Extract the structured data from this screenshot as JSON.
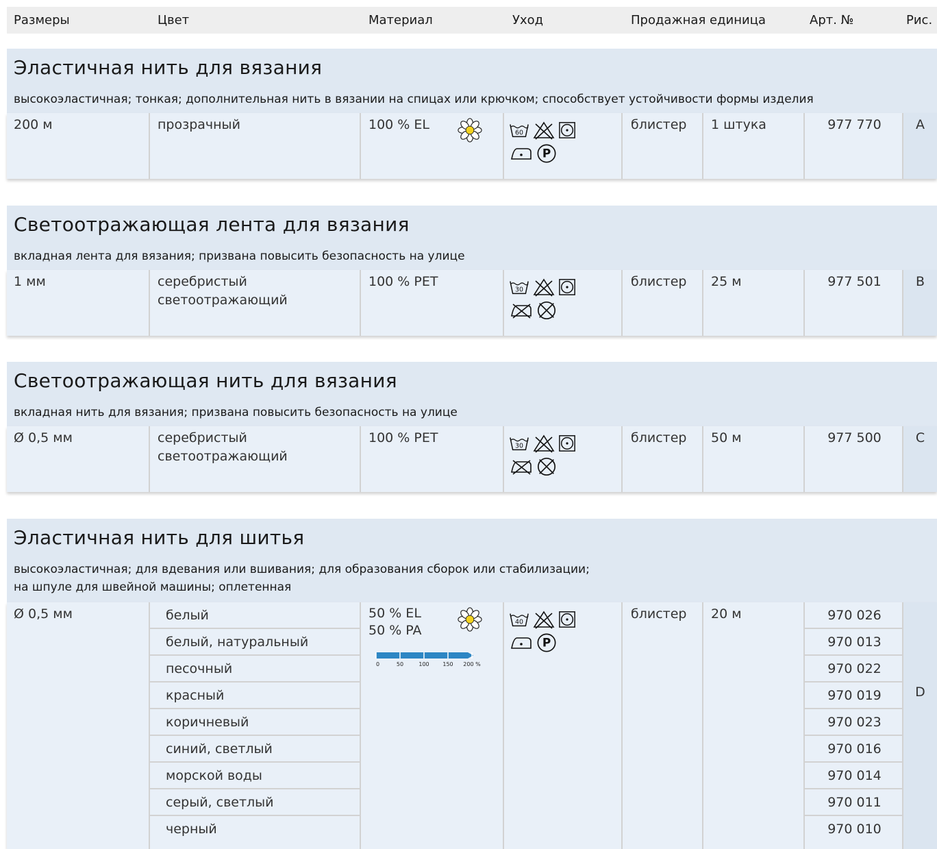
{
  "header": {
    "size": "Размеры",
    "color": "Цвет",
    "material": "Материал",
    "care": "Уход",
    "unit": "Продажная единица",
    "art": "Арт. №",
    "pic": "Рис."
  },
  "sections": [
    {
      "title": "Эластичная нить для вязания",
      "description": "высокоэластичная; тонкая; дополнительная нить в вязании на спицах или крючком; способствует устойчивости формы изделия",
      "size": "200 м",
      "color": "прозрачный",
      "material": "100 % EL",
      "wash_temp": "60",
      "pack": "блистер",
      "quantity": "1 штука",
      "art": "977 770",
      "pic": "A"
    },
    {
      "title": "Светоотражающая лента для вязания",
      "description": "вкладная лента для вязания; призвана повысить безопасность на улице",
      "size": "1 мм",
      "color": "серебристый светоотражающий",
      "material": "100 % PET",
      "wash_temp": "30",
      "pack": "блистер",
      "quantity": "25 м",
      "art": "977 501",
      "pic": "B"
    },
    {
      "title": "Светоотражающая нить для вязания",
      "description": "вкладная нить для вязания; призвана повысить безопасность на улице",
      "size": "Ø 0,5 мм",
      "color": "серебристый светоотражающий",
      "material": "100 % PET",
      "wash_temp": "30",
      "pack": "блистер",
      "quantity": "50 м",
      "art": "977 500",
      "pic": "C"
    },
    {
      "title": "Эластичная нить для шитья",
      "description_line1": "высокоэластичная; для вдевания или вшивания; для образования сборок или стабилизации;",
      "description_line2": "на шпуле для швейной машины; оплетенная",
      "size": "Ø 0,5 мм",
      "material_line1": "50 % EL",
      "material_line2": "50 % PA",
      "wash_temp": "40",
      "pack": "блистер",
      "quantity": "20 м",
      "pic": "D",
      "stretch_scale": {
        "ticks": [
          "0",
          "50",
          "100",
          "150",
          "200 %"
        ],
        "value_percent": 200
      },
      "variants": [
        {
          "color": "белый",
          "art": "970 026"
        },
        {
          "color": "белый, натуральный",
          "art": "970 013"
        },
        {
          "color": "песочный",
          "art": "970 022"
        },
        {
          "color": "красный",
          "art": "970 019"
        },
        {
          "color": "коричневый",
          "art": "970 023"
        },
        {
          "color": "синий, светлый",
          "art": "970 016"
        },
        {
          "color": "морской воды",
          "art": "970 014"
        },
        {
          "color": "серый, светлый",
          "art": "970 011"
        },
        {
          "color": "черный",
          "art": "970 010"
        }
      ]
    }
  ]
}
